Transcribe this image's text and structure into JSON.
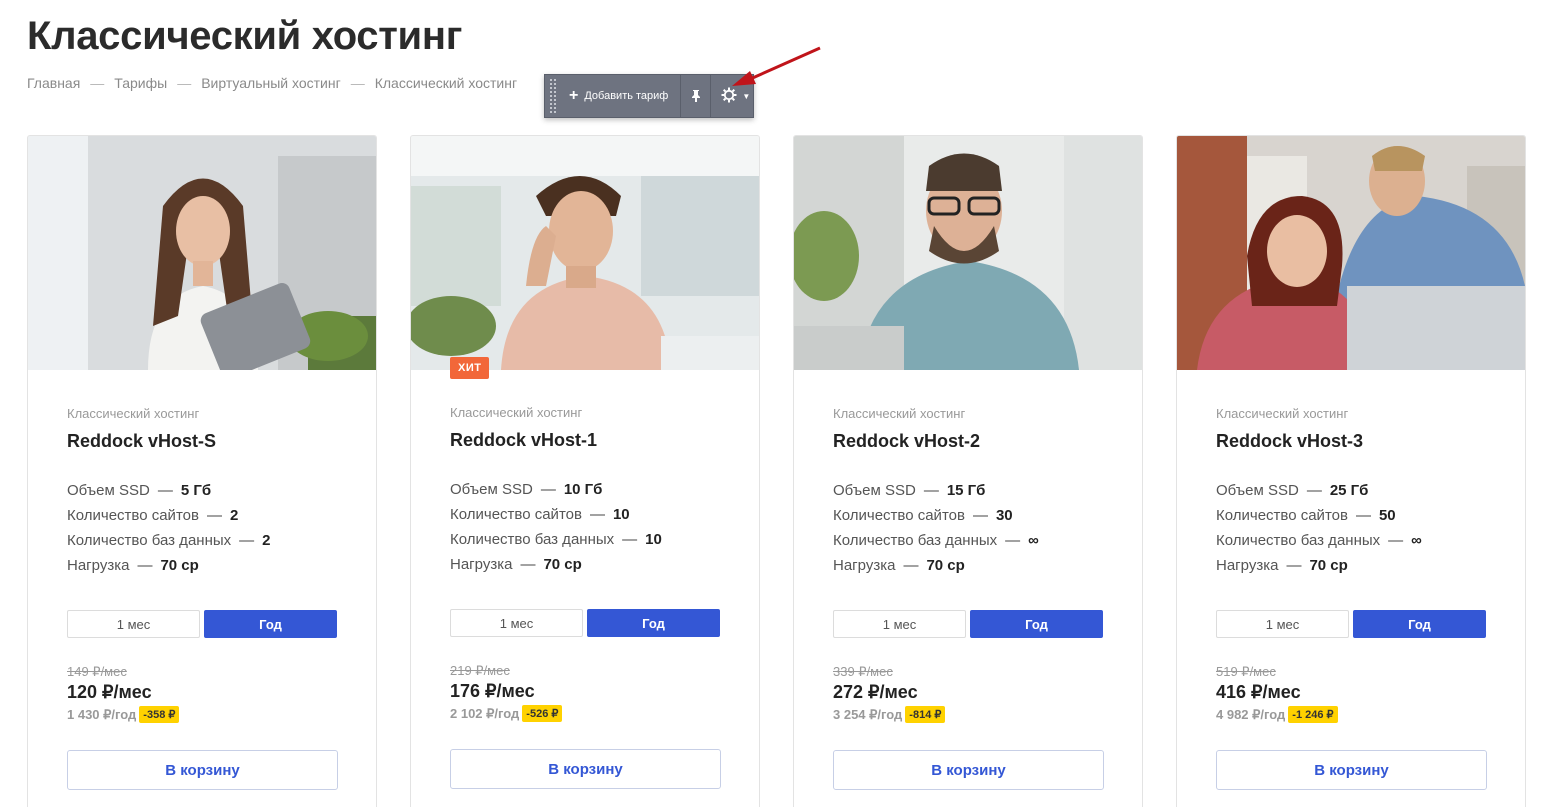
{
  "page": {
    "title": "Классический хостинг"
  },
  "breadcrumb": [
    {
      "label": "Главная"
    },
    {
      "label": "Тарифы"
    },
    {
      "label": "Виртуальный хостинг"
    },
    {
      "label": "Классический хостинг"
    }
  ],
  "breadcrumb_separator": "—",
  "admin_toolbar": {
    "add_label": "Добавить тариф",
    "icons": [
      "plus-icon",
      "pin-icon",
      "gear-icon",
      "caret-down-icon"
    ]
  },
  "annotation": {
    "icon": "red-arrow-icon",
    "color": "#c0141a"
  },
  "cards": [
    {
      "category": "Классический хостинг",
      "name": "Reddock vHost-S",
      "badge": null,
      "photo": "woman-with-tablet",
      "specs": [
        {
          "label": "Объем SSD",
          "value": "5 Гб"
        },
        {
          "label": "Количество сайтов",
          "value": "2"
        },
        {
          "label": "Количество баз данных",
          "value": "2"
        },
        {
          "label": "Нагрузка",
          "value": "70 cp"
        }
      ],
      "period_options": [
        "1 мес",
        "Год"
      ],
      "period_selected": "Год",
      "old_price": "149 ₽/мес",
      "price": "120 ₽/мес",
      "year_price": "1 430 ₽/год",
      "discount": "-358 ₽",
      "cart_label": "В корзину"
    },
    {
      "category": "Классический хостинг",
      "name": "Reddock vHost-1",
      "badge": "ХИТ",
      "photo": "man-thinking",
      "specs": [
        {
          "label": "Объем SSD",
          "value": "10 Гб"
        },
        {
          "label": "Количество сайтов",
          "value": "10"
        },
        {
          "label": "Количество баз данных",
          "value": "10"
        },
        {
          "label": "Нагрузка",
          "value": "70 cp"
        }
      ],
      "period_options": [
        "1 мес",
        "Год"
      ],
      "period_selected": "Год",
      "old_price": "219 ₽/мес",
      "price": "176 ₽/мес",
      "year_price": "2 102 ₽/год",
      "discount": "-526 ₽",
      "cart_label": "В корзину"
    },
    {
      "category": "Классический хостинг",
      "name": "Reddock vHost-2",
      "badge": null,
      "photo": "man-with-glasses",
      "specs": [
        {
          "label": "Объем SSD",
          "value": "15 Гб"
        },
        {
          "label": "Количество сайтов",
          "value": "30"
        },
        {
          "label": "Количество баз данных",
          "value": "∞"
        },
        {
          "label": "Нагрузка",
          "value": "70 cp"
        }
      ],
      "period_options": [
        "1 мес",
        "Год"
      ],
      "period_selected": "Год",
      "old_price": "339 ₽/мес",
      "price": "272 ₽/мес",
      "year_price": "3 254 ₽/год",
      "discount": "-814 ₽",
      "cart_label": "В корзину"
    },
    {
      "category": "Классический хостинг",
      "name": "Reddock vHost-3",
      "badge": null,
      "photo": "couple-at-laptop",
      "specs": [
        {
          "label": "Объем SSD",
          "value": "25 Гб"
        },
        {
          "label": "Количество сайтов",
          "value": "50"
        },
        {
          "label": "Количество баз данных",
          "value": "∞"
        },
        {
          "label": "Нагрузка",
          "value": "70 cp"
        }
      ],
      "period_options": [
        "1 мес",
        "Год"
      ],
      "period_selected": "Год",
      "old_price": "519 ₽/мес",
      "price": "416 ₽/мес",
      "year_price": "4 982 ₽/год",
      "discount": "-1 246 ₽",
      "cart_label": "В корзину"
    }
  ],
  "colors": {
    "accent": "#3457d5",
    "hit_badge": "#f26739",
    "discount_badge": "#ffd200"
  }
}
